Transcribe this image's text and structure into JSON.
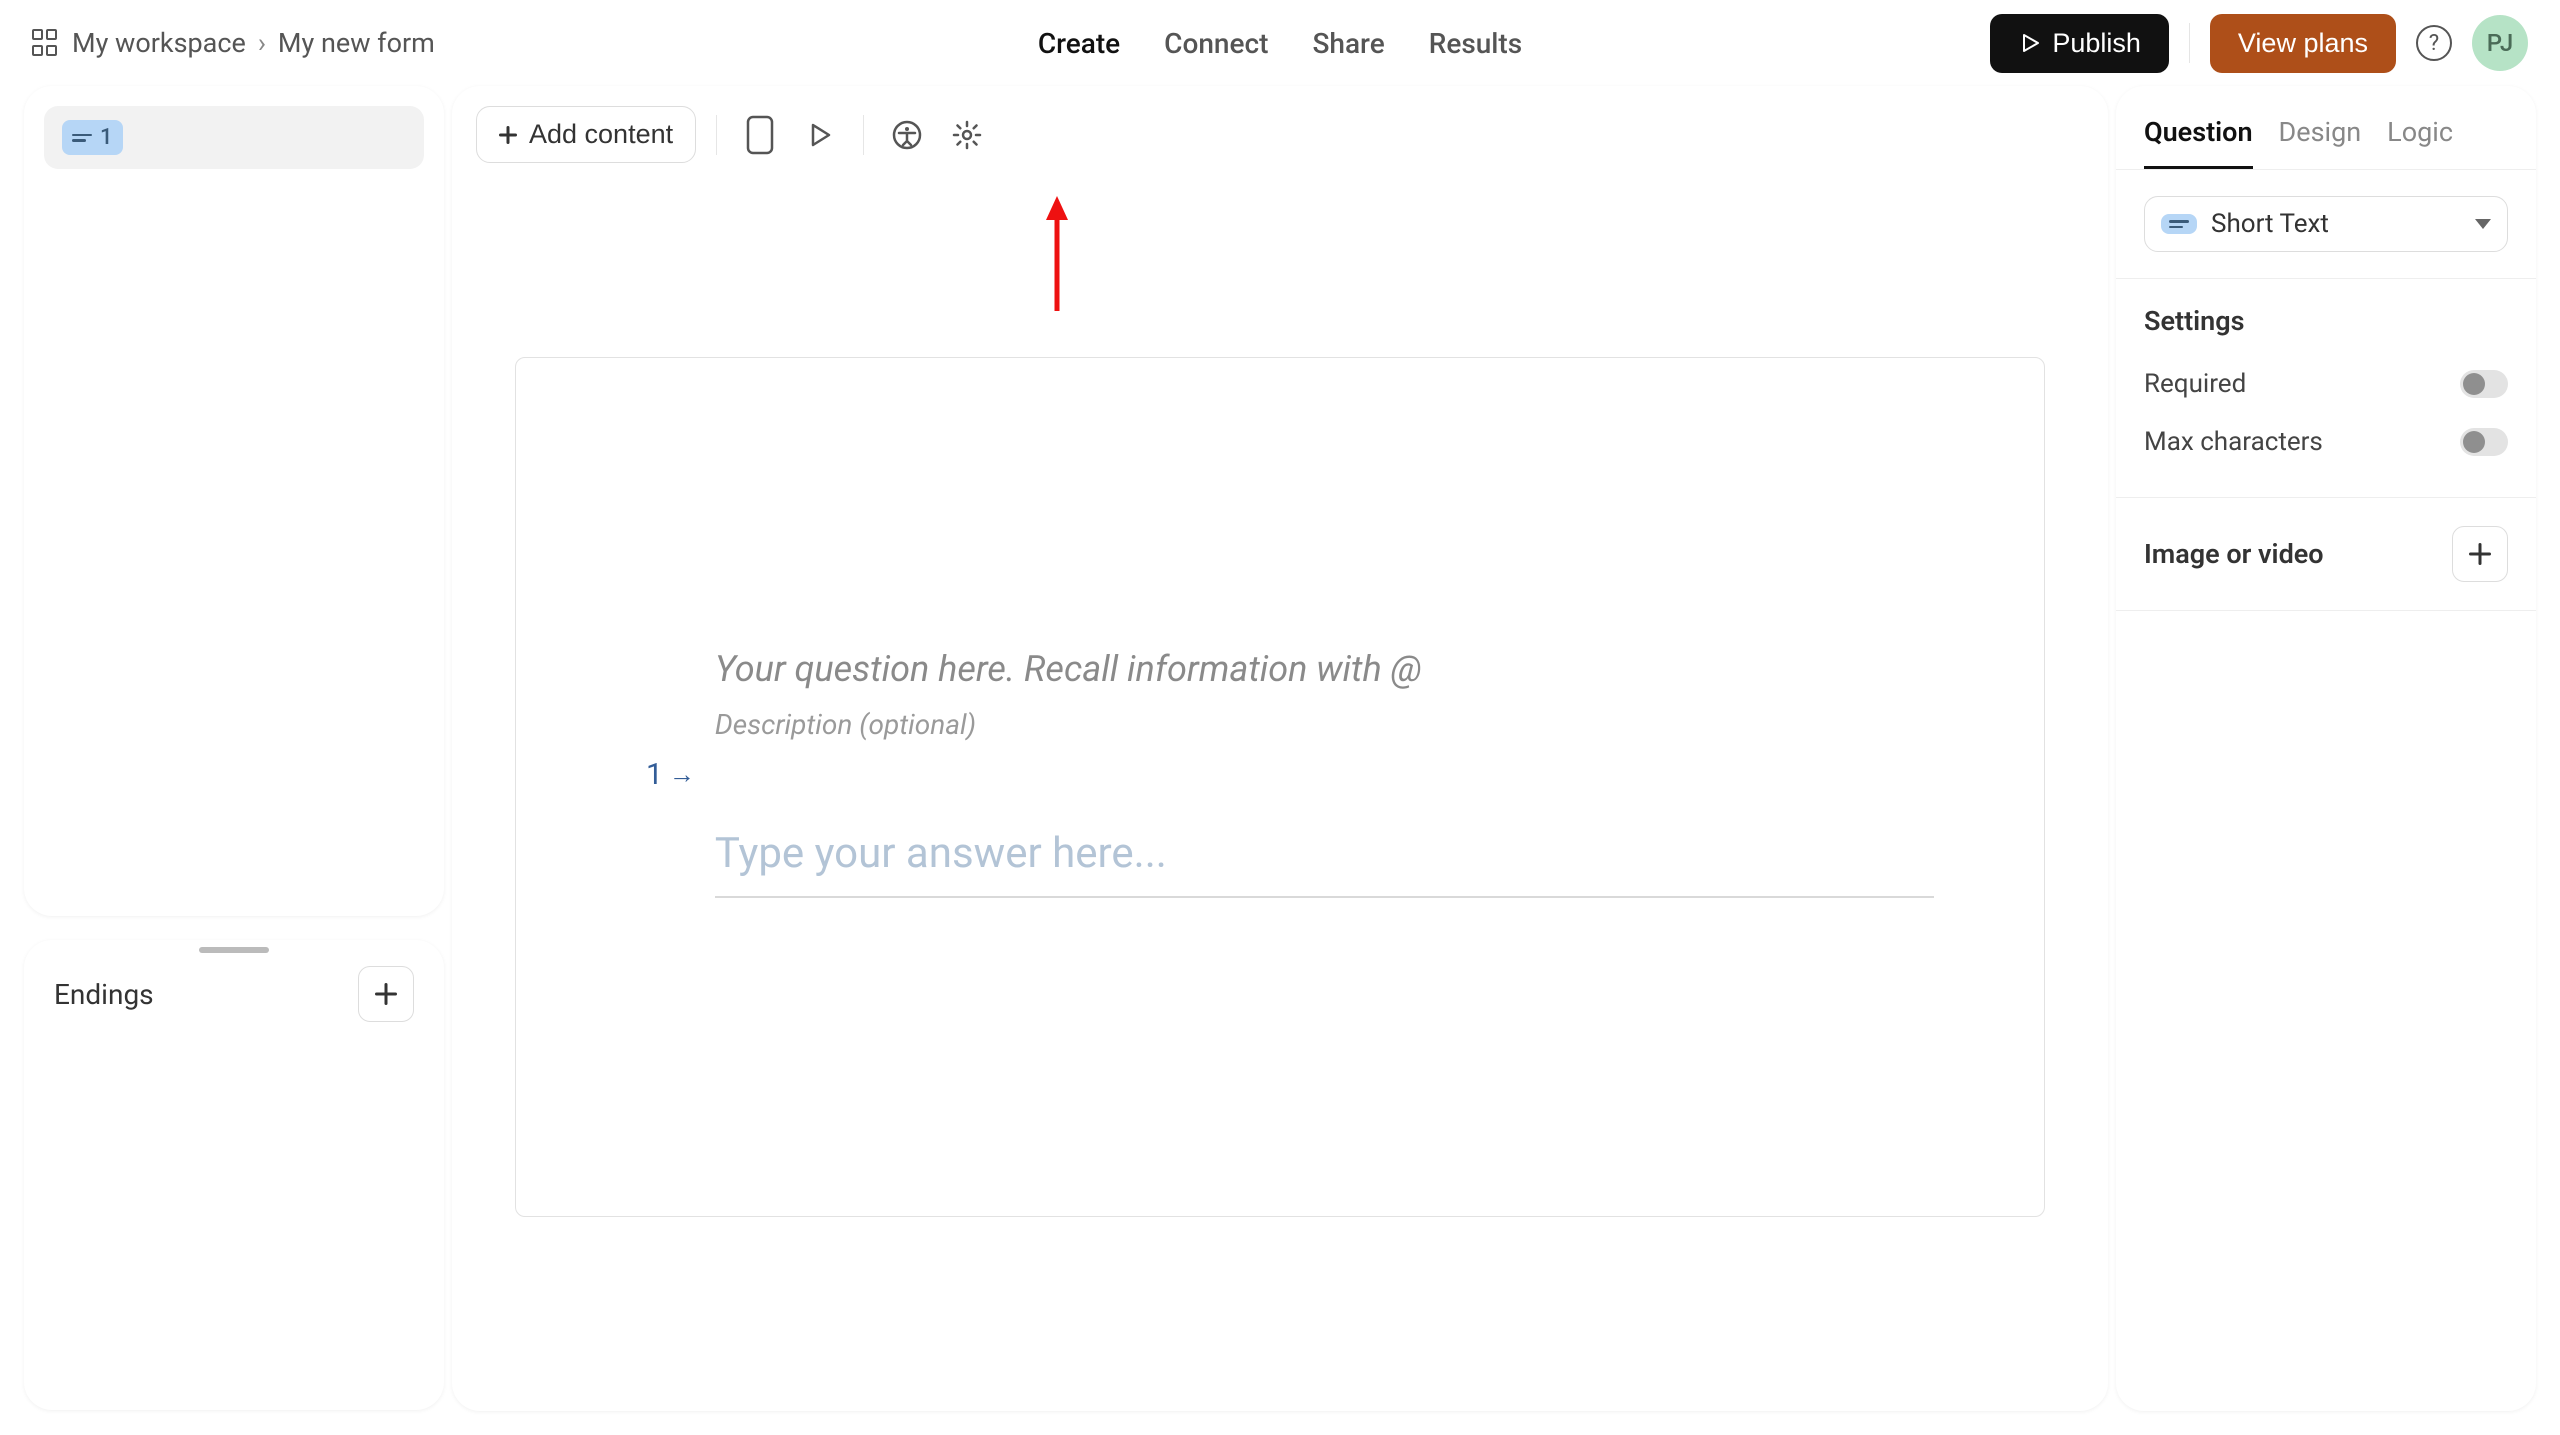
{
  "breadcrumbs": {
    "workspace": "My workspace",
    "form": "My new form"
  },
  "nav": {
    "create": "Create",
    "connect": "Connect",
    "share": "Share",
    "results": "Results"
  },
  "actions": {
    "publish": "Publish",
    "view_plans": "View plans",
    "avatar_initials": "PJ"
  },
  "toolbar": {
    "add_content": "Add content"
  },
  "left": {
    "question_number": "1",
    "endings": "Endings"
  },
  "canvas": {
    "q_number": "1",
    "title_placeholder": "Your question here. Recall information with @",
    "description_placeholder": "Description (optional)",
    "answer_placeholder": "Type your answer here..."
  },
  "right": {
    "tabs": {
      "question": "Question",
      "design": "Design",
      "logic": "Logic"
    },
    "qtype_label": "Short Text",
    "settings_heading": "Settings",
    "required_label": "Required",
    "maxchars_label": "Max characters",
    "media_label": "Image or video"
  }
}
